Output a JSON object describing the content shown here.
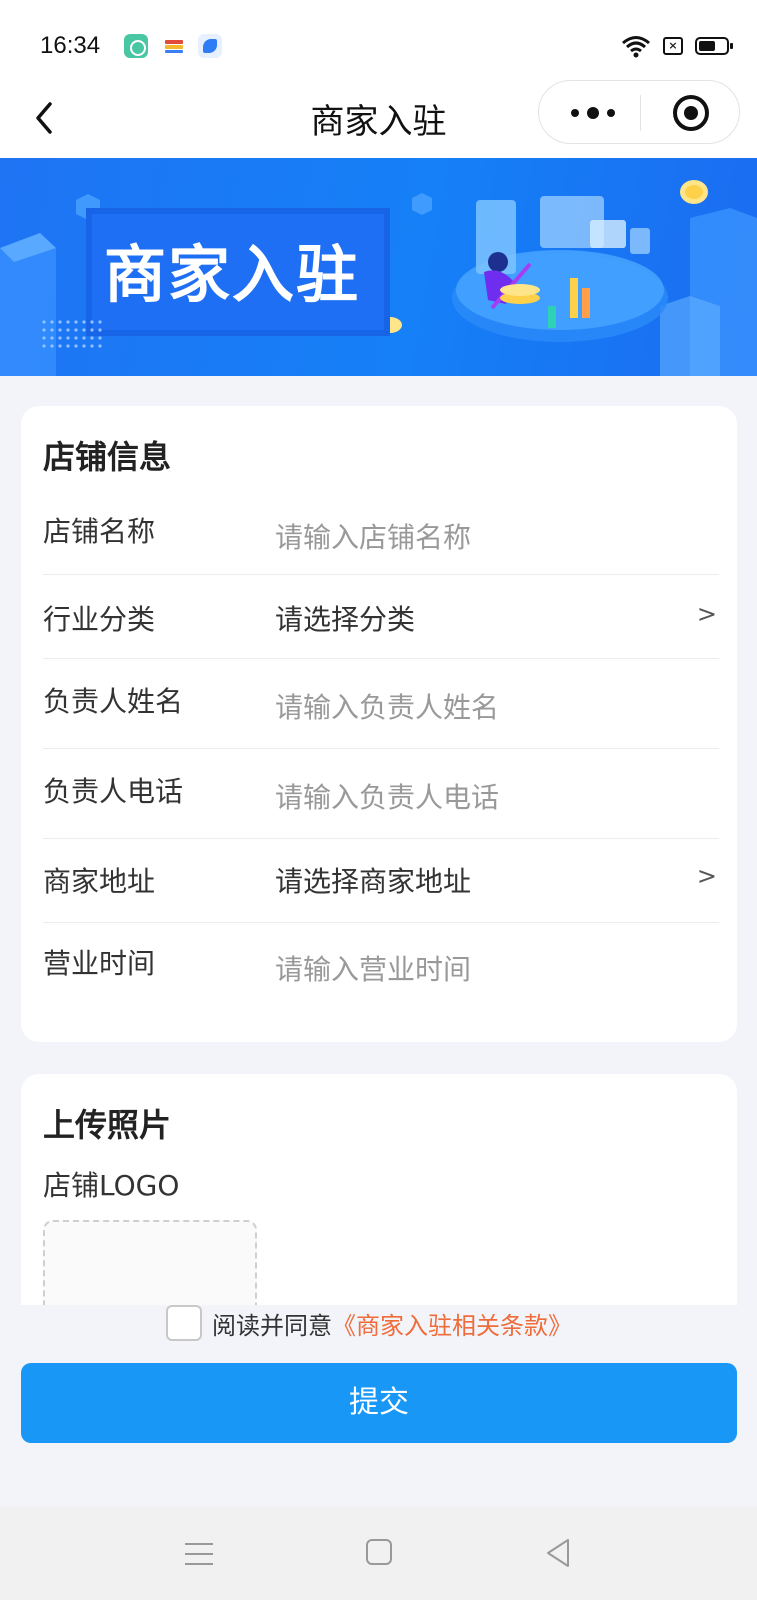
{
  "status_bar": {
    "time": "16:34",
    "icons": [
      "app-icon-green",
      "app-icon-stack",
      "app-icon-blue",
      "wifi-icon",
      "sim-x-icon",
      "battery-icon"
    ]
  },
  "nav": {
    "title": "商家入驻",
    "back_icon": "chevron-left-icon",
    "more_icon": "more-dots-icon",
    "close_icon": "target-icon"
  },
  "banner": {
    "title": "商家入驻"
  },
  "shop_info": {
    "title": "店铺信息",
    "fields": [
      {
        "label": "店铺名称",
        "placeholder": "请输入店铺名称"
      },
      {
        "label": "行业分类",
        "value": "请选择分类",
        "arrow": ">"
      },
      {
        "label": "负责人姓名",
        "placeholder": "请输入负责人姓名"
      },
      {
        "label": "负责人电话",
        "placeholder": "请输入负责人电话"
      },
      {
        "label": "商家地址",
        "value": "请选择商家地址",
        "arrow": ">"
      },
      {
        "label": "营业时间",
        "placeholder": "请输入营业时间"
      }
    ]
  },
  "upload": {
    "title": "上传照片",
    "logo_label": "店铺LOGO"
  },
  "agreement": {
    "text": "阅读并同意",
    "link": "《商家入驻相关条款》"
  },
  "submit_label": "提交",
  "colors": {
    "primary": "#1897f7",
    "banner": "#1f74f4",
    "link": "#ef6b3a",
    "background": "#f3f4f9"
  }
}
